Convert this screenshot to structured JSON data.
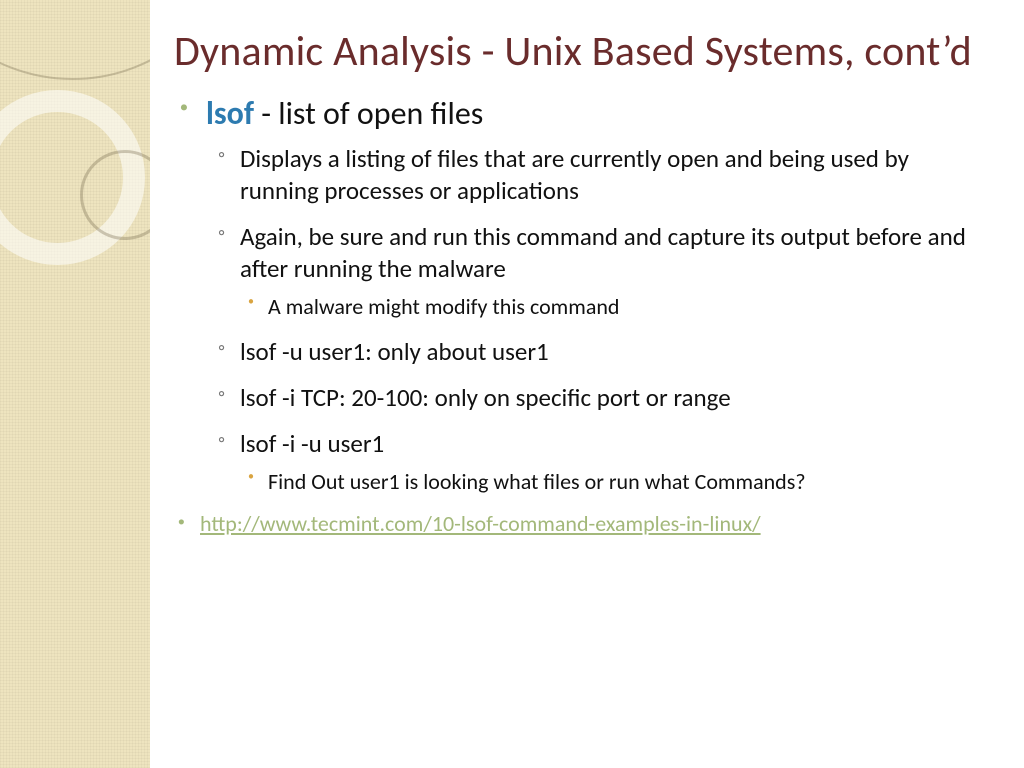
{
  "title": "Dynamic Analysis - Unix Based Systems, cont’d",
  "main": {
    "command": "lsof",
    "desc": " - list of open files",
    "subs": [
      {
        "text": "Displays a listing of files that are currently open and being used by running processes or applications"
      },
      {
        "text": "Again, be sure and run this command and capture its output before and after running the malware",
        "subs": [
          {
            "text": "A malware might modify this command"
          }
        ]
      },
      {
        "text": "lsof -u user1:  only about user1"
      },
      {
        "text": "lsof -i TCP: 20-100:  only on specific port or range"
      },
      {
        "text": "lsof -i -u user1",
        "subs": [
          {
            "text": "Find Out user1 is looking what files or run what Commands?"
          }
        ]
      }
    ]
  },
  "link": "http://www.tecmint.com/10-lsof-command-examples-in-linux/"
}
